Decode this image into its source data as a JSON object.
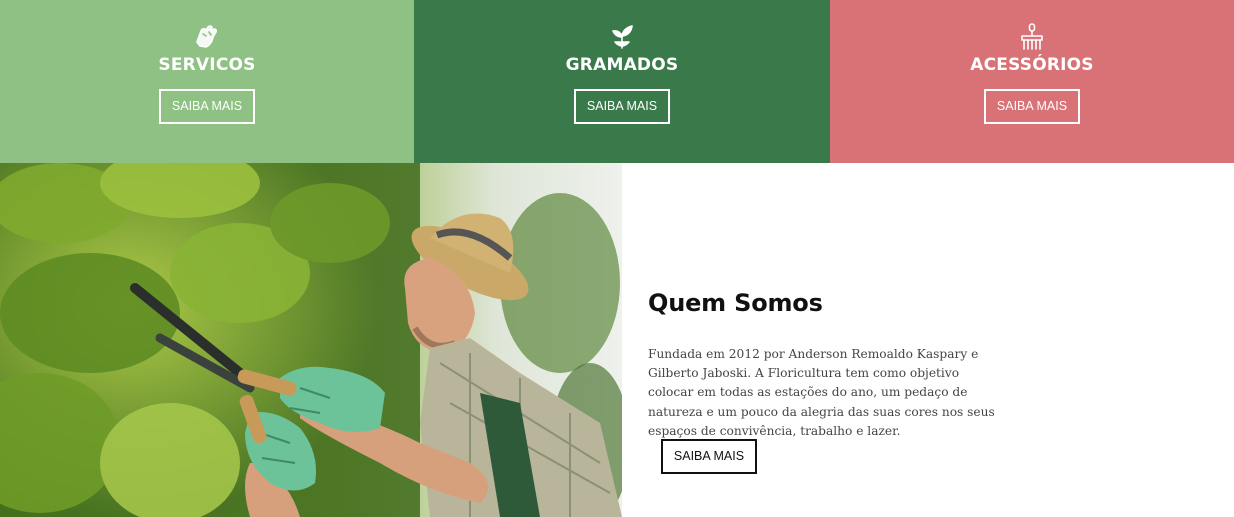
{
  "panels": [
    {
      "title": "SERVICOS",
      "button": "SAIBA MAIS",
      "icon": "gloves-icon",
      "color": "#8fc184"
    },
    {
      "title": "GRAMADOS",
      "button": "SAIBA MAIS",
      "icon": "sprout-icon",
      "color": "#3a7a4a"
    },
    {
      "title": "ACESSÓRIOS",
      "button": "SAIBA MAIS",
      "icon": "rake-icon",
      "color": "#d87276"
    }
  ],
  "about": {
    "title": "Quem Somos",
    "text": "Fundada em 2012 por Anderson Remoaldo Kaspary e Gilberto Jaboski. A Floricultura tem como objetivo colocar em todas as estações do ano, um pedaço de natureza e um pouco da alegria das suas cores nos seus espaços de convivência, trabalho e lazer.",
    "button": "SAIBA MAIS"
  },
  "colors": {
    "text_dark": "#111111",
    "text_body": "#444444"
  }
}
